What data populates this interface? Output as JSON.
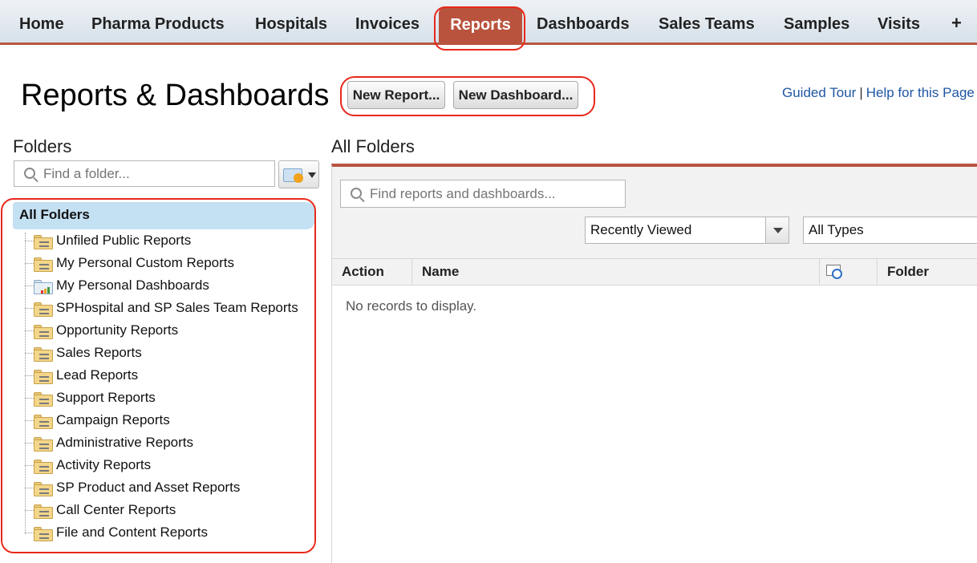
{
  "tabs": {
    "home": "Home",
    "pharma_products": "Pharma Products",
    "hospitals": "Hospitals",
    "invoices": "Invoices",
    "reports": "Reports",
    "dashboards": "Dashboards",
    "sales_teams": "Sales Teams",
    "samples": "Samples",
    "visits": "Visits",
    "more": "+"
  },
  "header": {
    "title": "Reports & Dashboards",
    "new_report_label": "New Report...",
    "new_dashboard_label": "New Dashboard...",
    "guided_tour": "Guided Tour",
    "separator": "|",
    "help": "Help for this Page"
  },
  "sidebar": {
    "title": "Folders",
    "search_placeholder": "Find a folder...",
    "all_folders": "All Folders",
    "folders": [
      {
        "label": "Unfiled Public Reports",
        "icon": "report-folder-icon"
      },
      {
        "label": "My Personal Custom Reports",
        "icon": "report-folder-icon"
      },
      {
        "label": "My Personal Dashboards",
        "icon": "dashboard-folder-icon"
      },
      {
        "label": "SPHospital and SP Sales Team Reports",
        "icon": "report-folder-icon"
      },
      {
        "label": "Opportunity Reports",
        "icon": "report-folder-icon"
      },
      {
        "label": "Sales Reports",
        "icon": "report-folder-icon"
      },
      {
        "label": "Lead Reports",
        "icon": "report-folder-icon"
      },
      {
        "label": "Support Reports",
        "icon": "report-folder-icon"
      },
      {
        "label": "Campaign Reports",
        "icon": "report-folder-icon"
      },
      {
        "label": "Administrative Reports",
        "icon": "report-folder-icon"
      },
      {
        "label": "Activity Reports",
        "icon": "report-folder-icon"
      },
      {
        "label": "SP Product and Asset Reports",
        "icon": "report-folder-icon"
      },
      {
        "label": "Call Center Reports",
        "icon": "report-folder-icon"
      },
      {
        "label": "File and Content Reports",
        "icon": "report-folder-icon"
      }
    ]
  },
  "main": {
    "title": "All Folders",
    "search_placeholder": "Find reports and dashboards...",
    "view_filter": "Recently Viewed",
    "type_filter": "All Types",
    "columns": {
      "action": "Action",
      "name": "Name",
      "folder": "Folder"
    },
    "empty_message": "No records to display."
  },
  "colors": {
    "accent": "#b9533e",
    "highlight": "#c4e0f3",
    "link": "#1f56a3",
    "annotation": "#e8281b"
  }
}
